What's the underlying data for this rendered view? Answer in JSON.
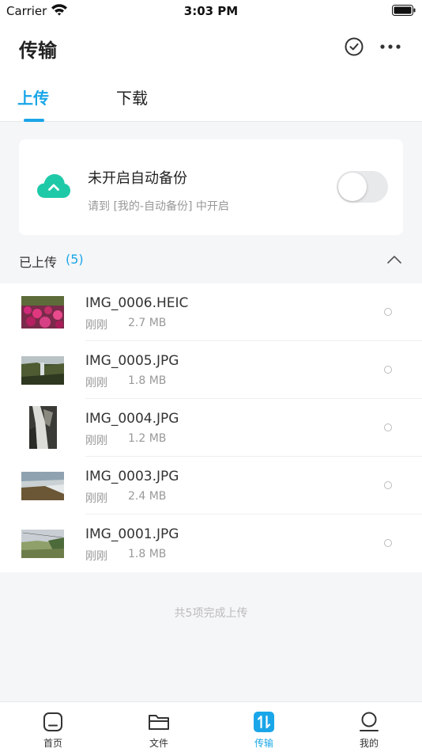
{
  "status_bar": {
    "carrier": "Carrier",
    "time": "3:03 PM"
  },
  "header": {
    "title": "传输"
  },
  "tabs": [
    {
      "label": "上传",
      "active": true
    },
    {
      "label": "下载",
      "active": false
    }
  ],
  "backup": {
    "title": "未开启自动备份",
    "subtitle": "请到 [我的-自动备份] 中开启",
    "enabled": false
  },
  "uploaded_section": {
    "label": "已上传",
    "count": "(5)"
  },
  "files": [
    {
      "name": "IMG_0006.HEIC",
      "time": "刚刚",
      "size": "2.7 MB"
    },
    {
      "name": "IMG_0005.JPG",
      "time": "刚刚",
      "size": "1.8 MB"
    },
    {
      "name": "IMG_0004.JPG",
      "time": "刚刚",
      "size": "1.2 MB"
    },
    {
      "name": "IMG_0003.JPG",
      "time": "刚刚",
      "size": "2.4 MB"
    },
    {
      "name": "IMG_0001.JPG",
      "time": "刚刚",
      "size": "1.8 MB"
    }
  ],
  "footer_note": "共5项完成上传",
  "bottom_tabs": [
    {
      "label": "首页",
      "icon": "home-icon",
      "active": false
    },
    {
      "label": "文件",
      "icon": "folder-icon",
      "active": false
    },
    {
      "label": "传输",
      "icon": "transfer-icon",
      "active": true
    },
    {
      "label": "我的",
      "icon": "profile-icon",
      "active": false
    }
  ],
  "colors": {
    "accent": "#1aa6e8",
    "cloud": "#1ec9a8"
  }
}
